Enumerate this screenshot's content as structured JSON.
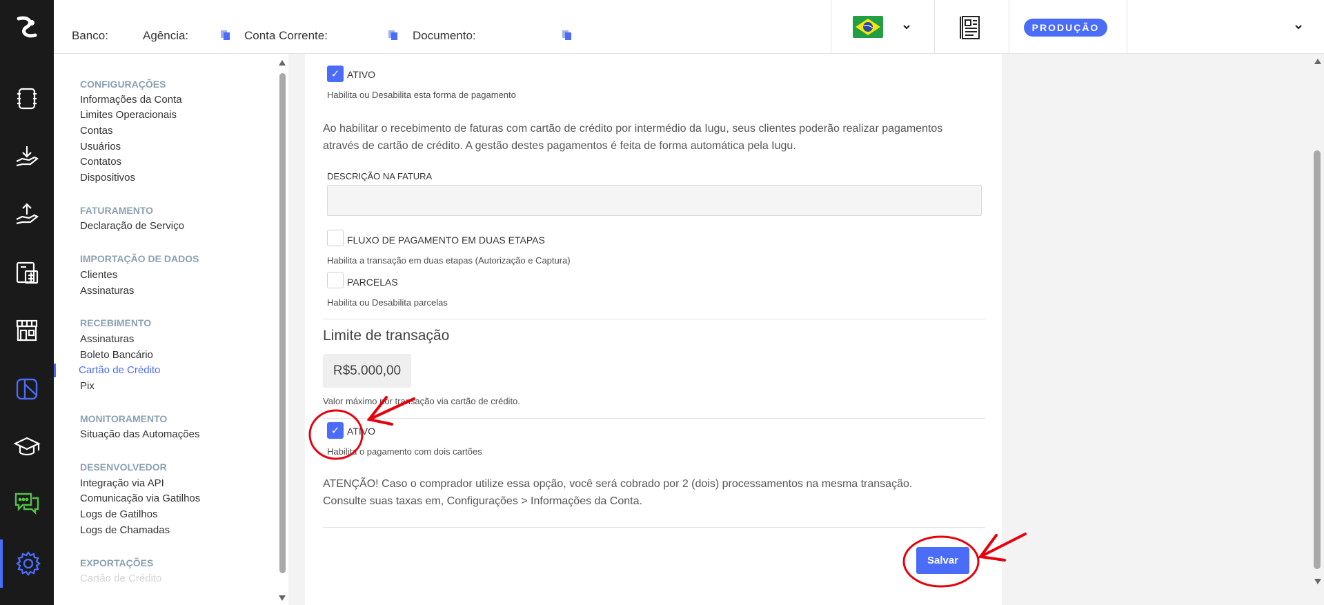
{
  "topbar": {
    "banco_label": "Banco:",
    "agencia_label": "Agência:",
    "conta_label": "Conta Corrente:",
    "documento_label": "Documento:",
    "environment_badge": "PRODUÇÃO",
    "flag_icon": "brazil-flag-icon",
    "report_icon": "report-document-icon"
  },
  "rail": {
    "icons": [
      "app-logo-icon",
      "notebook-icon",
      "receive-money-icon",
      "send-money-icon",
      "calculator-icon",
      "store-icon",
      "card-slash-icon",
      "graduation-cap-icon",
      "chat-support-icon",
      "gear-icon"
    ],
    "active": "gear-icon",
    "accent": "#4a6cf7"
  },
  "submenu": {
    "sections": [
      {
        "title": "CONFIGURAÇÕES",
        "items": [
          "Informações da Conta",
          "Limites Operacionais",
          "Contas",
          "Usuários",
          "Contatos",
          "Dispositivos"
        ]
      },
      {
        "title": "FATURAMENTO",
        "items": [
          "Declaração de Serviço"
        ]
      },
      {
        "title": "IMPORTAÇÃO DE DADOS",
        "items": [
          "Clientes",
          "Assinaturas"
        ]
      },
      {
        "title": "RECEBIMENTO",
        "items": [
          "Assinaturas",
          "Boleto Bancário",
          "Cartão de Crédito",
          "Pix"
        ]
      },
      {
        "title": "MONITORAMENTO",
        "items": [
          "Situação das Automações"
        ]
      },
      {
        "title": "DESENVOLVEDOR",
        "items": [
          "Integração via API",
          "Comunicação via Gatilhos",
          "Logs de Gatilhos",
          "Logs de Chamadas"
        ]
      },
      {
        "title": "EXPORTAÇÕES",
        "items": [
          "Cartão de Crédito"
        ]
      }
    ],
    "active_item": "Cartão de Crédito"
  },
  "content": {
    "ativo_label": "ATIVO",
    "ativo_hint": "Habilita ou Desabilita esta forma de pagamento",
    "intro_line1": "Ao habilitar o recebimento de faturas com cartão de crédito por intermédio da Iugu, seus clientes poderão realizar pagamentos",
    "intro_line2": "através de cartão de crédito. A gestão destes pagamentos é feita de forma automática pela Iugu.",
    "descricao_label": "DESCRIÇÃO NA FATURA",
    "descricao_value": "",
    "fluxo_label": "FLUXO DE PAGAMENTO EM DUAS ETAPAS",
    "fluxo_hint": "Habilita a transação em duas etapas (Autorização e Captura)",
    "parcelas_label": "PARCELAS",
    "parcelas_hint": "Habilita ou Desabilita parcelas",
    "limite_title": "Limite de transação",
    "limite_value": "R$5.000,00",
    "limite_hint": "Valor máximo por transação via cartão de crédito.",
    "ativo2_label": "ATIVO",
    "ativo2_hint": "Habilita o pagamento com dois cartões",
    "warning_line1": "ATENÇÃO! Caso o comprador utilize essa opção, você será cobrado por 2 (dois) processamentos na mesma transação.",
    "warning_line2": "Consulte suas taxas em, Configurações > Informações da Conta.",
    "save_label": "Salvar",
    "checkboxes": {
      "ativo": true,
      "fluxo": false,
      "parcelas": false,
      "ativo2": true
    },
    "annotation_color": "#e8000b"
  }
}
